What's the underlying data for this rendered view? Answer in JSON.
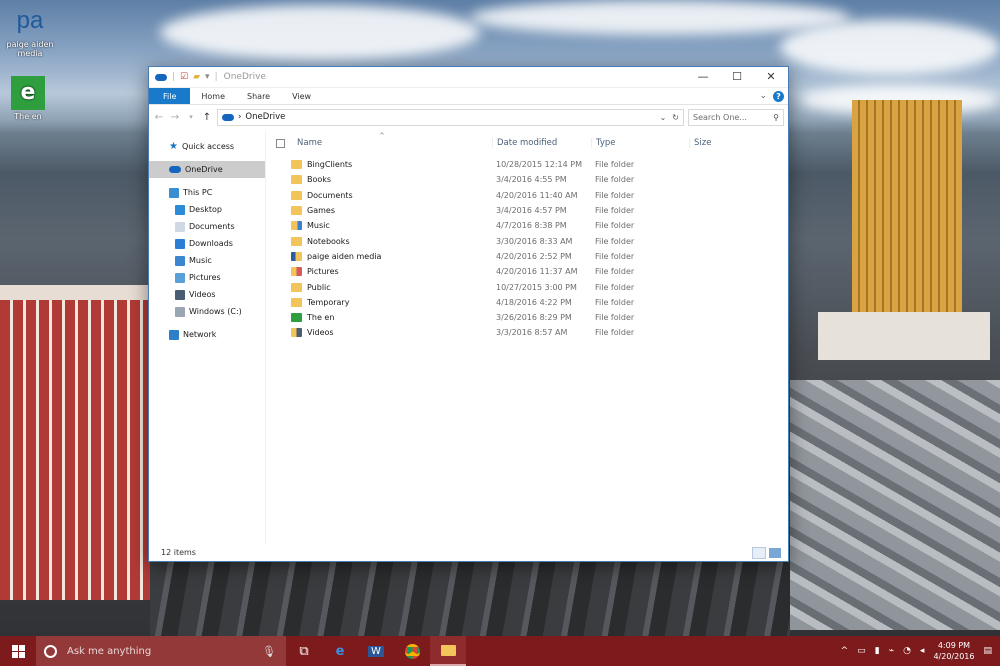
{
  "desktop": {
    "icons": [
      {
        "label_line1": "paige aiden",
        "label_line2": "media",
        "glyph": "pa"
      },
      {
        "label_line1": "The en",
        "label_line2": "",
        "glyph": "e"
      }
    ]
  },
  "window": {
    "title": "OneDrive",
    "controls": {
      "minimize": "—",
      "maximize": "☐",
      "close": "✕"
    },
    "ribbon_tabs": [
      "File",
      "Home",
      "Share",
      "View"
    ],
    "address": {
      "path": "OneDrive",
      "search_placeholder": "Search One..."
    },
    "columns": {
      "name": "Name",
      "date": "Date modified",
      "type": "Type",
      "size": "Size"
    },
    "nav_pane": {
      "quick_access": "Quick access",
      "onedrive": "OneDrive",
      "this_pc": "This PC",
      "pc_items": [
        "Desktop",
        "Documents",
        "Downloads",
        "Music",
        "Pictures",
        "Videos",
        "Windows (C:)"
      ],
      "network": "Network"
    },
    "files": [
      {
        "name": "BingClients",
        "date": "10/28/2015 12:14 PM",
        "type": "File folder",
        "icon": "folder"
      },
      {
        "name": "Books",
        "date": "3/4/2016 4:55 PM",
        "type": "File folder",
        "icon": "folder"
      },
      {
        "name": "Documents",
        "date": "4/20/2016 11:40 AM",
        "type": "File folder",
        "icon": "folder"
      },
      {
        "name": "Games",
        "date": "3/4/2016 4:57 PM",
        "type": "File folder",
        "icon": "folder"
      },
      {
        "name": "Music",
        "date": "4/7/2016 8:38 PM",
        "type": "File folder",
        "icon": "music-folder"
      },
      {
        "name": "Notebooks",
        "date": "3/30/2016 8:33 AM",
        "type": "File folder",
        "icon": "folder"
      },
      {
        "name": "paige aiden media",
        "date": "4/20/2016 2:52 PM",
        "type": "File folder",
        "icon": "pa-folder"
      },
      {
        "name": "Pictures",
        "date": "4/20/2016 11:37 AM",
        "type": "File folder",
        "icon": "pictures-folder"
      },
      {
        "name": "Public",
        "date": "10/27/2015 3:00 PM",
        "type": "File folder",
        "icon": "folder"
      },
      {
        "name": "Temporary",
        "date": "4/18/2016 4:22 PM",
        "type": "File folder",
        "icon": "folder"
      },
      {
        "name": "The en",
        "date": "3/26/2016 8:29 PM",
        "type": "File folder",
        "icon": "green-e"
      },
      {
        "name": "Videos",
        "date": "3/3/2016 8:57 AM",
        "type": "File folder",
        "icon": "videos-folder"
      }
    ],
    "status": "12 items"
  },
  "taskbar": {
    "search_placeholder": "Ask me anything",
    "time": "4:09 PM",
    "date": "4/20/2016"
  },
  "colors": {
    "accent": "#1979ca",
    "taskbar": "#7d1a1c",
    "folder": "#f2c45a"
  }
}
